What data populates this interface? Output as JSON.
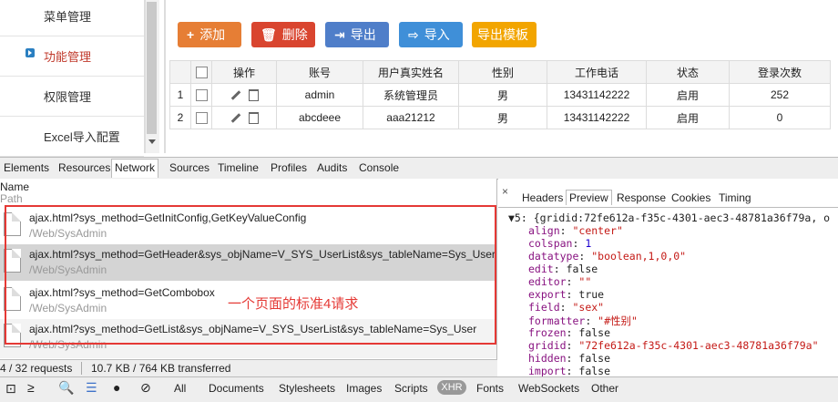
{
  "sidebar": {
    "items": [
      {
        "label": "菜单管理"
      },
      {
        "label": "功能管理",
        "active": true
      },
      {
        "label": "权限管理"
      },
      {
        "label": "Excel导入配置"
      }
    ]
  },
  "toolbar": {
    "add": "添加",
    "delete": "删除",
    "export": "导出",
    "import": "导入",
    "export_template": "导出模板",
    "colors": {
      "add": "#e67e35",
      "delete": "#d9452f",
      "export": "#4f7ec9",
      "import": "#3f8fd8",
      "export_template": "#f2a500"
    }
  },
  "grid": {
    "columns": [
      "操作",
      "账号",
      "用户真实姓名",
      "性别",
      "工作电话",
      "状态",
      "登录次数"
    ],
    "rows": [
      {
        "index": "1",
        "account": "admin",
        "name": "系统管理员",
        "gender": "男",
        "phone": "13431142222",
        "status": "启用",
        "logins": "252"
      },
      {
        "index": "2",
        "account": "abcdeee",
        "name": "aaa21212",
        "gender": "男",
        "phone": "13431142222",
        "status": "启用",
        "logins": "0"
      }
    ]
  },
  "devtools": {
    "tabs": [
      "Elements",
      "Resources",
      "Network",
      "Sources",
      "Timeline",
      "Profiles",
      "Audits",
      "Console"
    ],
    "active_tab": "Network",
    "network": {
      "header_name": "Name",
      "header_path": "Path",
      "requests": [
        {
          "name": "ajax.html?sys_method=GetInitConfig,GetKeyValueConfig",
          "path": "/Web/SysAdmin"
        },
        {
          "name": "ajax.html?sys_method=GetHeader&sys_objName=V_SYS_UserList&sys_tableName=Sys_User",
          "path": "/Web/SysAdmin"
        },
        {
          "name": "ajax.html?sys_method=GetCombobox",
          "path": "/Web/SysAdmin"
        },
        {
          "name": "ajax.html?sys_method=GetList&sys_objName=V_SYS_UserList&sys_tableName=Sys_User",
          "path": "/Web/SysAdmin"
        }
      ],
      "annotation": "一个页面的标准4请求",
      "status_requests": "4 / 32 requests",
      "status_transfer": "10.7 KB / 764 KB transferred"
    },
    "filters": [
      "All",
      "Documents",
      "Stylesheets",
      "Images",
      "Scripts",
      "XHR",
      "Fonts",
      "WebSockets",
      "Other"
    ],
    "active_filter": "XHR",
    "detail": {
      "close": "×",
      "tabs": [
        "Headers",
        "Preview",
        "Response",
        "Cookies",
        "Timing"
      ],
      "active_tab": "Preview",
      "preview_header": "▼5: {gridid:72fe612a-f35c-4301-aec3-48781a36f79a, o",
      "preview_lines": [
        {
          "key": "align",
          "value": "\"center\"",
          "type": "string"
        },
        {
          "key": "colspan",
          "value": "1",
          "type": "number"
        },
        {
          "key": "datatype",
          "value": "\"boolean,1,0,0\"",
          "type": "string"
        },
        {
          "key": "edit",
          "value": "false",
          "type": "plain"
        },
        {
          "key": "editor",
          "value": "\"\"",
          "type": "string"
        },
        {
          "key": "export",
          "value": "true",
          "type": "plain"
        },
        {
          "key": "field",
          "value": "\"sex\"",
          "type": "string"
        },
        {
          "key": "formatter",
          "value": "\"#性别\"",
          "type": "string"
        },
        {
          "key": "frozen",
          "value": "false",
          "type": "plain"
        },
        {
          "key": "gridid",
          "value": "\"72fe612a-f35c-4301-aec3-48781a36f79a\"",
          "type": "string"
        },
        {
          "key": "hidden",
          "value": "false",
          "type": "plain"
        },
        {
          "key": "import",
          "value": "false",
          "type": "plain"
        }
      ]
    }
  }
}
